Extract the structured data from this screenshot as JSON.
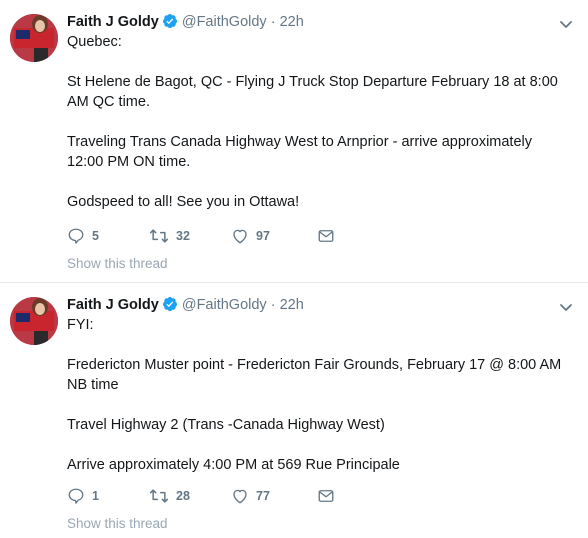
{
  "tweets": [
    {
      "author_name": "Faith J Goldy",
      "handle": "@FaithGoldy",
      "separator": "·",
      "time": "22h",
      "paragraphs": [
        "Quebec:",
        "St Helene de Bagot, QC - Flying J Truck Stop Departure February 18 at 8:00 AM QC time.",
        "Traveling Trans Canada  Highway West to Arnprior - arrive approximately 12:00 PM ON time.",
        "Godspeed to all! See you in Ottawa!"
      ],
      "replies": "5",
      "retweets": "32",
      "likes": "97",
      "show_thread": "Show this thread"
    },
    {
      "author_name": "Faith J Goldy",
      "handle": "@FaithGoldy",
      "separator": "·",
      "time": "22h",
      "paragraphs": [
        "FYI:",
        "Fredericton Muster point - Fredericton Fair Grounds, February 17 @ 8:00 AM NB time",
        "Travel Highway 2 (Trans -Canada Highway West)",
        "Arrive approximately 4:00 PM at 569 Rue Principale"
      ],
      "replies": "1",
      "retweets": "28",
      "likes": "77",
      "show_thread": "Show this thread"
    }
  ],
  "colors": {
    "text": "#14171a",
    "secondary": "#657786",
    "verified": "#1da1f2",
    "divider": "#e6ecf0"
  },
  "icons": [
    "verified-badge-icon",
    "chevron-down-icon",
    "reply-icon",
    "retweet-icon",
    "like-icon",
    "direct-message-icon"
  ]
}
